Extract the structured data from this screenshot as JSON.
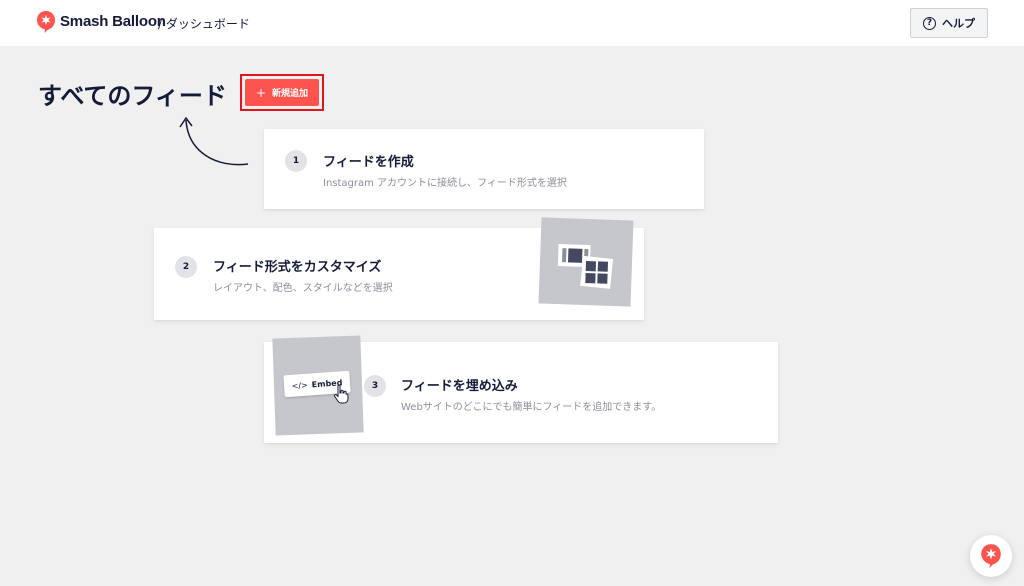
{
  "header": {
    "brand": "Smash Balloon",
    "breadcrumb": "/ ダッシュボード",
    "help_label": "ヘルプ",
    "help_icon": "question-circle-icon",
    "logo_icon": "balloon-logo-icon"
  },
  "page": {
    "title": "すべてのフィード",
    "add_button_label": "新規追加",
    "add_button_icon": "plus-icon"
  },
  "steps": [
    {
      "number": "1",
      "title": "フィードを作成",
      "description": "Instagram アカウントに接続し、フィード形式を選択"
    },
    {
      "number": "2",
      "title": "フィード形式をカスタマイズ",
      "description": "レイアウト、配色、スタイルなどを選択"
    },
    {
      "number": "3",
      "title": "フィードを埋め込み",
      "description": "Webサイトのどこにでも簡単にフィードを追加できます。"
    }
  ],
  "embed_illustration": {
    "code_icon": "</>",
    "label": "Embed"
  },
  "colors": {
    "accent": "#fe544f",
    "highlight_outline": "#e0161b",
    "text_dark": "#141b38",
    "text_muted": "#8c8f9a",
    "background": "#f0f0f1"
  }
}
